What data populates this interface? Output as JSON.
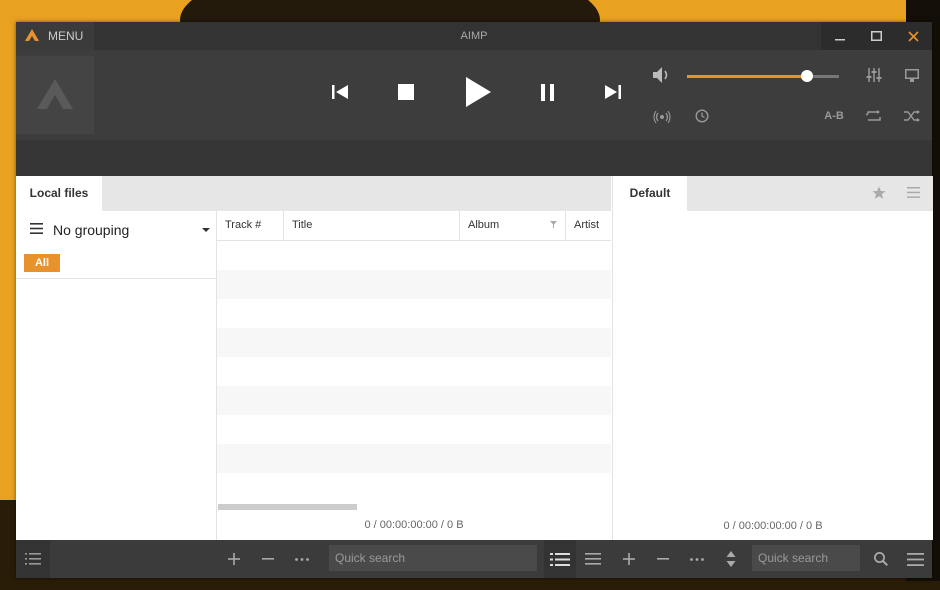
{
  "window": {
    "title": "AIMP",
    "menu_label": "MENU"
  },
  "player": {
    "volume_fraction": 0.79,
    "ab_label": "A-B"
  },
  "left_pane": {
    "tab_label": "Local files",
    "grouping_label": "No grouping",
    "all_label": "All",
    "columns": [
      "Track #",
      "Title",
      "Album",
      "Artist"
    ],
    "stats": "0 / 00:00:00:00 / 0 B"
  },
  "right_pane": {
    "tab_label": "Default",
    "stats": "0 / 00:00:00:00 / 0 B"
  },
  "bottom": {
    "search_placeholder_left": "Quick search",
    "search_placeholder_right": "Quick search"
  },
  "colors": {
    "accent": "#e8922e",
    "titlebar": "#333333",
    "player_bg": "#3d3d3d"
  }
}
